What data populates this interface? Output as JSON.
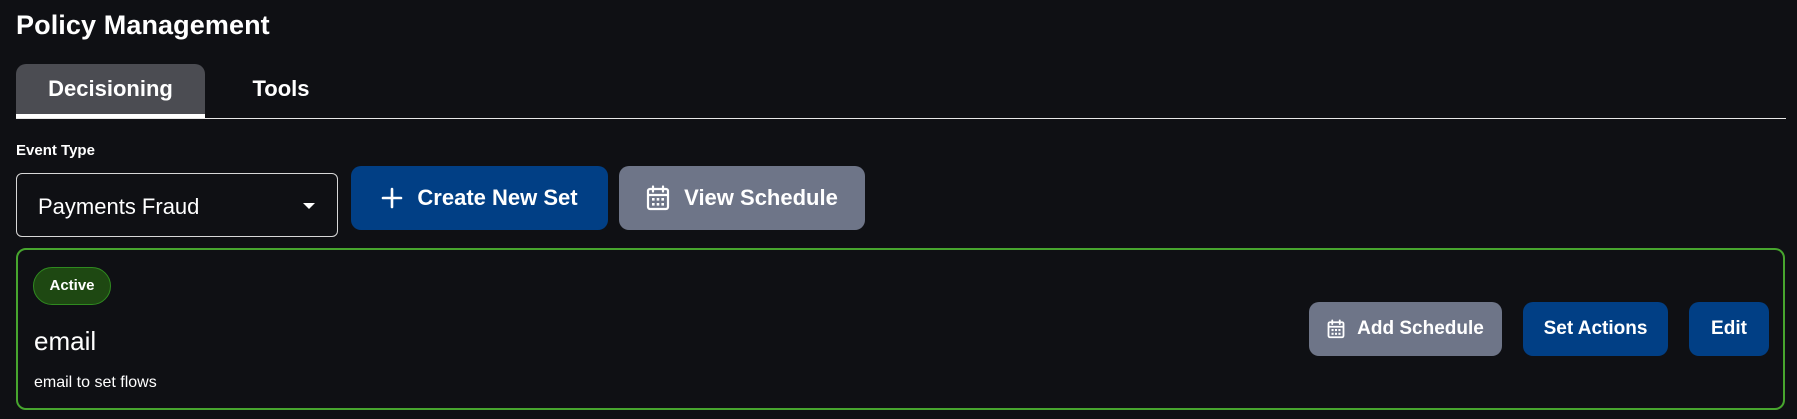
{
  "page": {
    "title": "Policy Management"
  },
  "tabs": [
    {
      "label": "Decisioning",
      "active": true
    },
    {
      "label": "Tools",
      "active": false
    }
  ],
  "event_type": {
    "label": "Event Type",
    "selected": "Payments Fraud"
  },
  "toolbar": {
    "create_label": "Create New Set",
    "view_schedule_label": "View Schedule"
  },
  "set_card": {
    "status": "Active",
    "name": "email",
    "description": "email to set flows",
    "add_schedule_label": "Add Schedule",
    "set_actions_label": "Set Actions",
    "edit_label": "Edit"
  },
  "icons": {
    "create": "plus-icon",
    "view_schedule": "calendar-icon",
    "add_schedule": "calendar-icon",
    "dropdown": "caret-down-icon"
  },
  "colors": {
    "background": "#0f1014",
    "primary_button": "#013f85",
    "secondary_button": "#6e7588",
    "active_border": "#47a52e",
    "active_badge": "#1e4812"
  }
}
